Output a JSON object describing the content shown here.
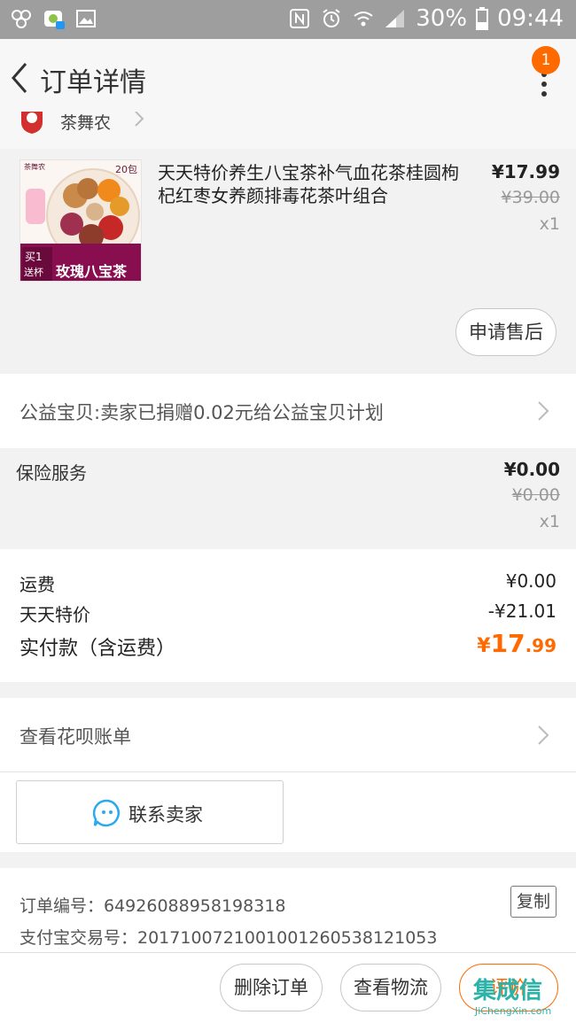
{
  "status_bar": {
    "battery": "30%",
    "time": "09:44"
  },
  "nav": {
    "title": "订单详情",
    "badge_count": "1"
  },
  "shop": {
    "name": "茶舞农"
  },
  "product": {
    "title": "天天特价养生八宝茶补气血花茶桂圆枸杞红枣女养颜排毒花茶叶组合",
    "thumb_brand": "茶舞农",
    "thumb_pack": "20包",
    "thumb_promo_buy": "买1",
    "thumb_promo_gift": "送杯",
    "thumb_name": "玫瑰八宝茶",
    "price_now": "¥17.99",
    "price_old": "¥39.00",
    "qty": "x1",
    "aftersale_label": "申请售后"
  },
  "charity": {
    "text": "公益宝贝:卖家已捐赠0.02元给公益宝贝计划"
  },
  "insurance": {
    "title": "保险服务",
    "price_now": "¥0.00",
    "price_old": "¥0.00",
    "qty": "x1"
  },
  "summary": {
    "shipping_label": "运费",
    "shipping_value": "¥0.00",
    "discount_label": "天天特价",
    "discount_value": "-¥21.01",
    "paid_label": "实付款（含运费）",
    "paid_yen": "¥",
    "paid_int": "17",
    "paid_dec": ".99"
  },
  "huabei": {
    "text": "查看花呗账单"
  },
  "contact": {
    "label": "联系卖家"
  },
  "order_info": {
    "order_no": "订单编号：64926088958198318",
    "alipay_no": "支付宝交易号：2017100721001001260538121053",
    "copy_label": "复制"
  },
  "bottom_bar": {
    "delete_label": "删除订单",
    "track_label": "查看物流",
    "rate_label": "评价"
  },
  "watermark": {
    "main": "集成信",
    "sub": "JiChengXin.com"
  },
  "colors": {
    "accent": "#ff6a00",
    "status_bar": "#9e9e9e"
  }
}
